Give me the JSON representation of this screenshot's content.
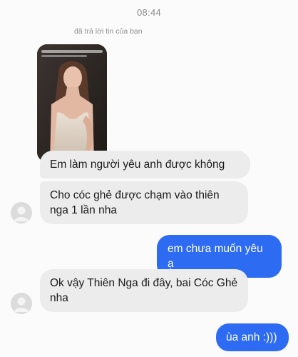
{
  "status_bar": {
    "time": "08:44"
  },
  "story_reply": {
    "note": "đã trả lời tin của bạn",
    "thumbnail_icon": "story-photo",
    "overlay_text": ""
  },
  "messages": [
    {
      "sender": "them",
      "text": "Em làm người yêu anh được không",
      "avatar_icon": ""
    },
    {
      "sender": "them",
      "text": "Cho cóc ghẻ được chạm vào thiên nga 1 lần nha",
      "avatar_icon": "person-placeholder-icon"
    },
    {
      "sender": "me",
      "text": "em chưa muốn yêu ạ"
    },
    {
      "sender": "them",
      "text": "Ok vậy Thiên Nga đi đây, bai Cóc Ghẻ nha",
      "avatar_icon": "person-placeholder-icon"
    },
    {
      "sender": "me",
      "text": "ùa anh :)))"
    }
  ],
  "colors": {
    "incoming_bubble": "#ececec",
    "outgoing_bubble": "#2d6bf3",
    "background": "#fbfbfb"
  }
}
